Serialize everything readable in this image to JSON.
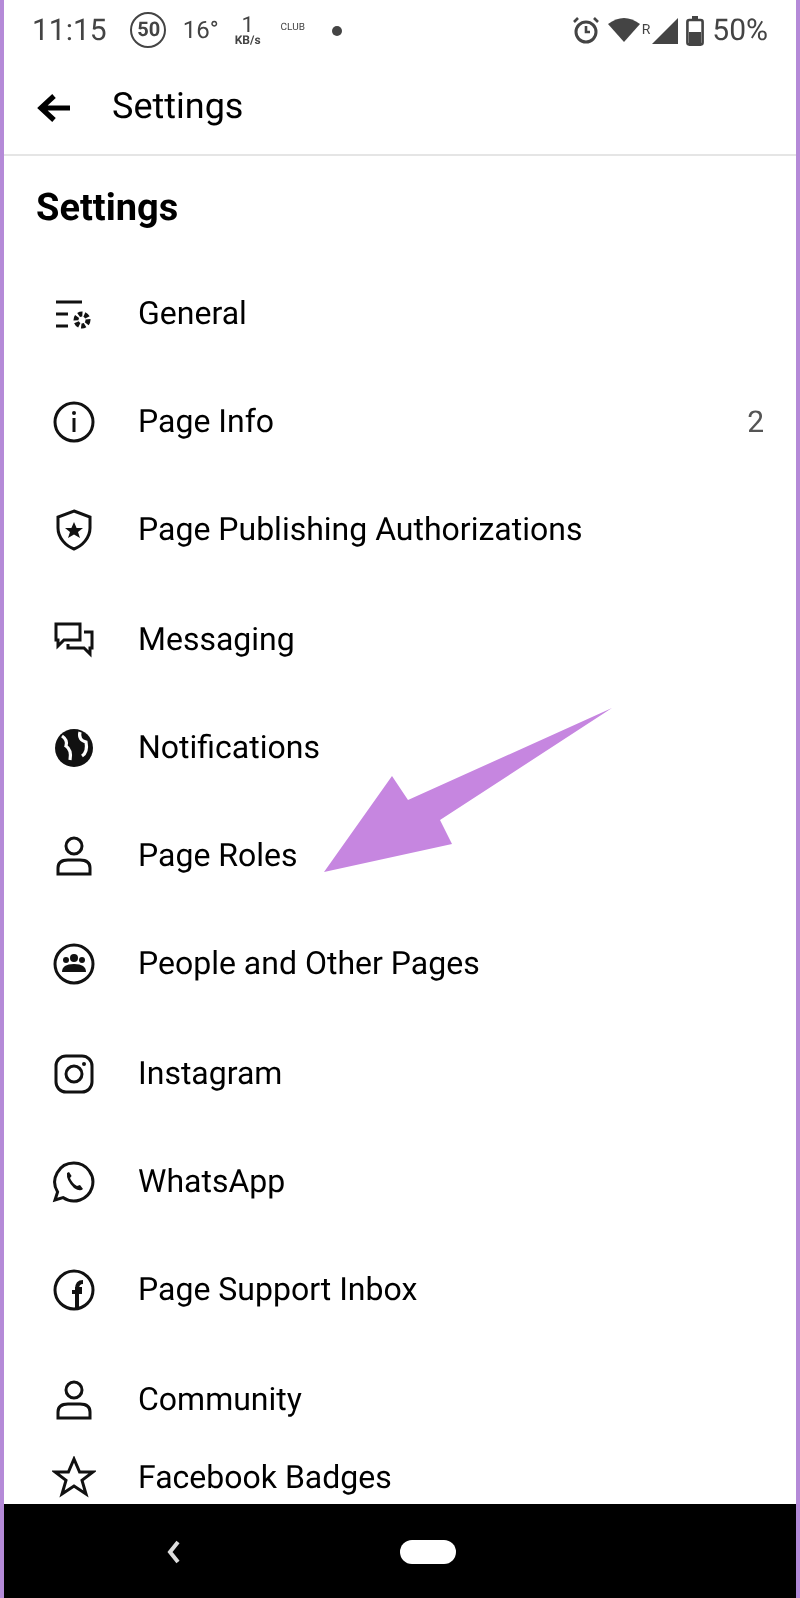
{
  "status_bar": {
    "time": "11:15",
    "speed_badge": "50",
    "temperature": "16°",
    "data_rate": "1",
    "data_unit": "KB/s",
    "network_label": "CLUB",
    "battery": "50%",
    "signal_roaming": "R"
  },
  "app_bar": {
    "title": "Settings"
  },
  "section_title": "Settings",
  "items": [
    {
      "label": "General"
    },
    {
      "label": "Page Info",
      "count": "2"
    },
    {
      "label": "Page Publishing Authorizations"
    },
    {
      "label": "Messaging"
    },
    {
      "label": "Notifications"
    },
    {
      "label": "Page Roles"
    },
    {
      "label": "People and Other Pages"
    },
    {
      "label": "Instagram"
    },
    {
      "label": "WhatsApp"
    },
    {
      "label": "Page Support Inbox"
    },
    {
      "label": "Community"
    },
    {
      "label": "Facebook Badges"
    }
  ]
}
